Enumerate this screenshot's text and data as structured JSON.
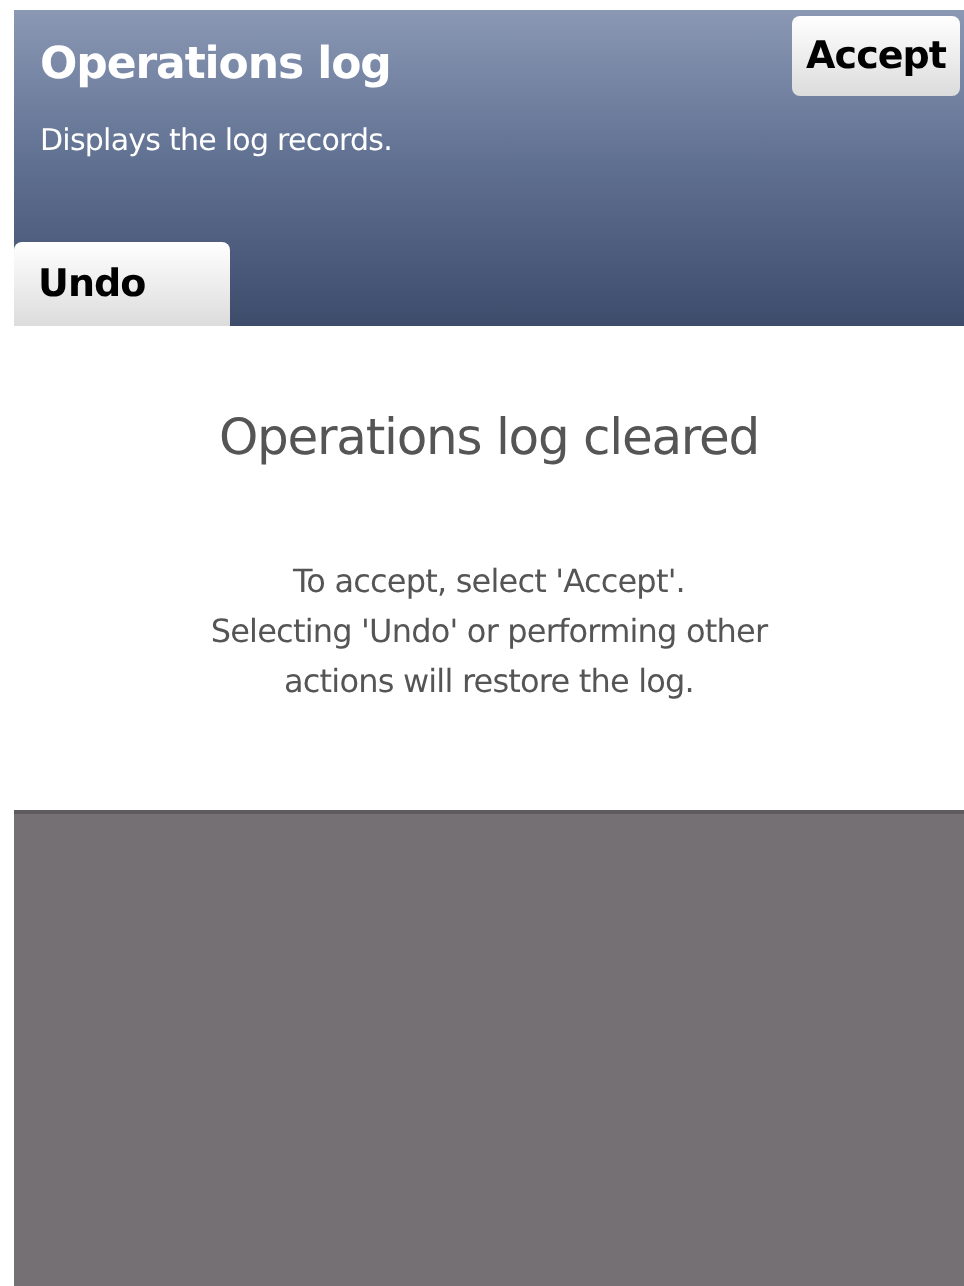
{
  "header": {
    "title": "Operations log",
    "subtitle": "Displays the log records."
  },
  "buttons": [
    {
      "kind": "accept",
      "label": "Accept"
    },
    {
      "kind": "undo",
      "label": "Undo"
    }
  ],
  "message": {
    "title": "Operations log cleared",
    "lines": [
      "To accept, select 'Accept'.",
      "Selecting 'Undo' or performing other",
      "actions will restore the log."
    ]
  }
}
